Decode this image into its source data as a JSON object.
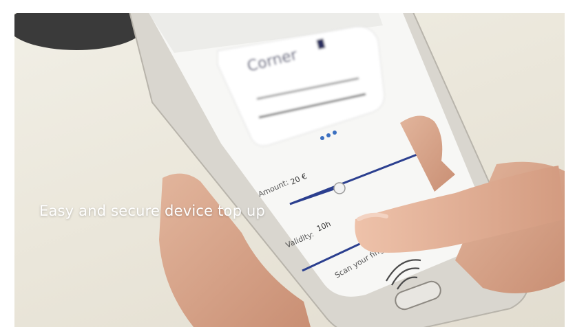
{
  "caption": "Easy and secure device top up",
  "phone": {
    "card_title": "Corner",
    "amount_label": "Amount:",
    "amount_value": "20 €",
    "validity_label": "Validity:",
    "validity_value": "10h",
    "scan_label": "Scan your fing"
  },
  "colors": {
    "slider_track": "#2b3f8f",
    "fingerprint": "#4a4a4a",
    "phone_screen": "#f7f7f5",
    "phone_frame": "#d9d6cf"
  }
}
